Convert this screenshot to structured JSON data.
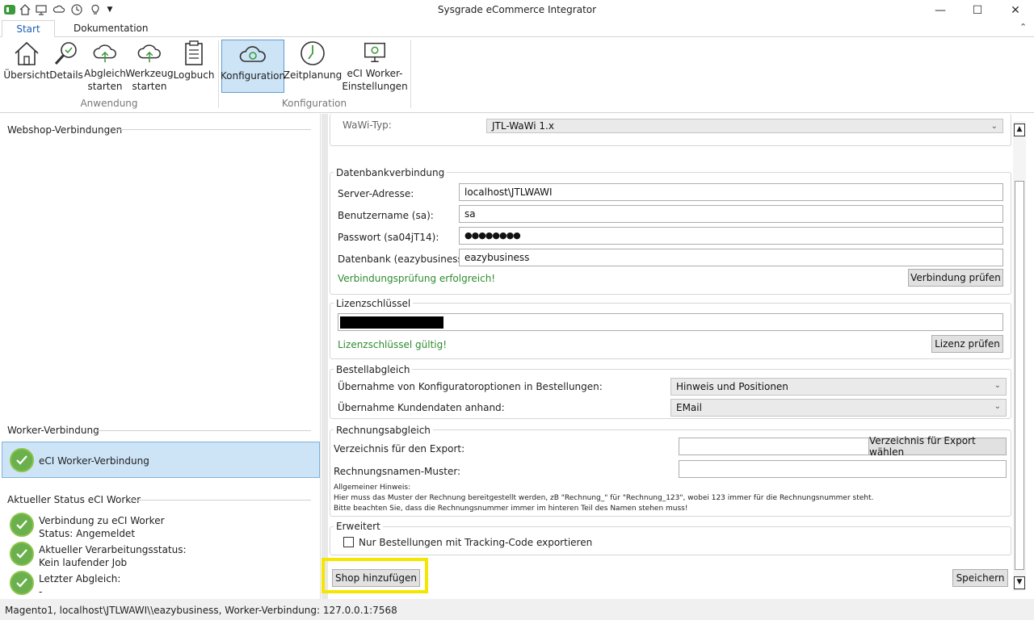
{
  "window": {
    "title": "Sysgrade eCommerce Integrator",
    "minimize_label": "—",
    "maximize_label": "☐",
    "close_label": "✕"
  },
  "tabs": [
    {
      "label": "Start",
      "active": true
    },
    {
      "label": "Dokumentation",
      "active": false
    }
  ],
  "ribbon": {
    "groups": [
      {
        "label": "Anwendung"
      },
      {
        "label": "Konfiguration"
      }
    ],
    "buttons": {
      "uebersicht": "Übersicht",
      "details": "Details",
      "abgleich_1": "Abgleich",
      "abgleich_2": "starten",
      "werkzeug_1": "Werkzeug",
      "werkzeug_2": "starten",
      "logbuch": "Logbuch",
      "konfiguration": "Konfiguration",
      "zeitplanung": "Zeitplanung",
      "worker_1": "eCI Worker-",
      "worker_2": "Einstellungen"
    }
  },
  "left": {
    "webshop_title": "Webshop-Verbindungen",
    "worker_title": "Worker-Verbindung",
    "worker_item": "eCI Worker-Verbindung",
    "status_title": "Aktueller Status eCI Worker",
    "status_items": [
      {
        "line1": "Verbindung zu eCI Worker",
        "line2": "Status: Angemeldet"
      },
      {
        "line1": "Aktueller Verarbeitungsstatus:",
        "line2": "Kein laufender Job"
      },
      {
        "line1": "Letzter Abgleich:",
        "line2": "-"
      }
    ]
  },
  "right": {
    "wawi_label": "WaWi-Typ:",
    "wawi_value": "JTL-WaWi 1.x",
    "db": {
      "legend": "Datenbankverbindung",
      "server_label": "Server-Adresse:",
      "server_value": "localhost\\JTLWAWI",
      "user_label": "Benutzername (sa):",
      "user_value": "sa",
      "pass_label": "Passwort (sa04jT14):",
      "pass_value": "●●●●●●●●",
      "dbname_label": "Datenbank (eazybusiness):",
      "dbname_value": "eazybusiness",
      "status": "Verbindungsprüfung erfolgreich!",
      "check_button": "Verbindung prüfen"
    },
    "license": {
      "legend": "Lizenzschlüssel",
      "status": "Lizenzschlüssel gültig!",
      "check_button": "Lizenz prüfen"
    },
    "orders": {
      "legend": "Bestellabgleich",
      "config_label": "Übernahme von Konfiguratoroptionen in Bestellungen:",
      "config_value": "Hinweis und Positionen",
      "customer_label": "Übernahme Kundendaten anhand:",
      "customer_value": "EMail"
    },
    "invoice": {
      "legend": "Rechnungsabgleich",
      "export_label": "Verzeichnis für den Export:",
      "export_value": "",
      "export_button": "Verzeichnis für Export wählen",
      "pattern_label": "Rechnungsnamen-Muster:",
      "pattern_value": "",
      "hint_1": "Allgemeiner Hinweis:",
      "hint_2": "Hier muss das Muster der Rechnung bereitgestellt werden, zB \"Rechnung_\" für \"Rechnung_123\", wobei 123 immer für die Rechnungsnummer steht.",
      "hint_3": "Bitte beachten Sie, dass die Rechnungsnummer immer im hinteren Teil des Namen stehen muss!"
    },
    "advanced": {
      "legend": "Erweitert",
      "tracking_label": "Nur Bestellungen mit Tracking-Code exportieren",
      "tracking_checked": false
    },
    "add_shop_button": "Shop hinzufügen",
    "save_button": "Speichern"
  },
  "status_bar": {
    "text": "Magento1, localhost\\JTLWAWI\\\\eazybusiness, Worker-Verbindung: 127.0.0.1:7568"
  },
  "colors": {
    "accent": "#1a5fb4",
    "selection": "#cde4f7",
    "success": "#2e8b2e",
    "highlight": "#f5e600"
  }
}
